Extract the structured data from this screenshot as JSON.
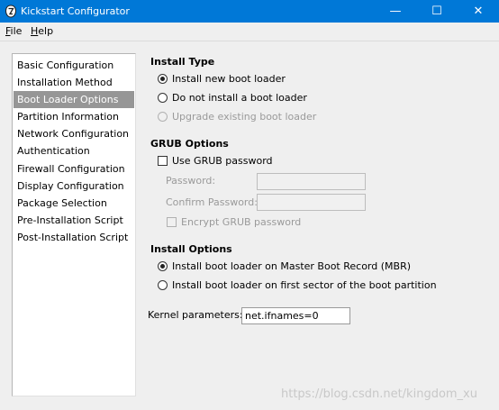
{
  "window": {
    "title": "Kickstart Configurator",
    "controls": {
      "minimize": "—",
      "maximize": "☐",
      "close": "✕"
    }
  },
  "menu": {
    "file_prefix": "F",
    "file_rest": "ile",
    "help_prefix": "H",
    "help_rest": "elp"
  },
  "sidebar": {
    "items": [
      {
        "label": "Basic Configuration",
        "selected": false
      },
      {
        "label": "Installation Method",
        "selected": false
      },
      {
        "label": "Boot Loader Options",
        "selected": true
      },
      {
        "label": "Partition Information",
        "selected": false
      },
      {
        "label": "Network Configuration",
        "selected": false
      },
      {
        "label": "Authentication",
        "selected": false
      },
      {
        "label": "Firewall Configuration",
        "selected": false
      },
      {
        "label": "Display Configuration",
        "selected": false
      },
      {
        "label": "Package Selection",
        "selected": false
      },
      {
        "label": "Pre-Installation Script",
        "selected": false
      },
      {
        "label": "Post-Installation Script",
        "selected": false
      }
    ]
  },
  "install_type": {
    "title": "Install Type",
    "options": [
      {
        "label": "Install new boot loader",
        "checked": true,
        "enabled": true
      },
      {
        "label": "Do not install a boot loader",
        "checked": false,
        "enabled": true
      },
      {
        "label": "Upgrade existing boot loader",
        "checked": false,
        "enabled": false
      }
    ]
  },
  "grub": {
    "title": "GRUB Options",
    "use_password_label": "Use GRUB password",
    "use_password_checked": false,
    "password_label": "Password:",
    "password_value": "",
    "confirm_label": "Confirm Password:",
    "confirm_value": "",
    "encrypt_label": "Encrypt GRUB password",
    "encrypt_checked": false
  },
  "install_options": {
    "title": "Install Options",
    "options": [
      {
        "label": "Install boot loader on Master Boot Record (MBR)",
        "checked": true
      },
      {
        "label": "Install boot loader on first sector of the boot partition",
        "checked": false
      }
    ]
  },
  "kernel": {
    "label": "Kernel parameters:",
    "value": "net.ifnames=0"
  },
  "watermark": "https://blog.csdn.net/kingdom_xu"
}
